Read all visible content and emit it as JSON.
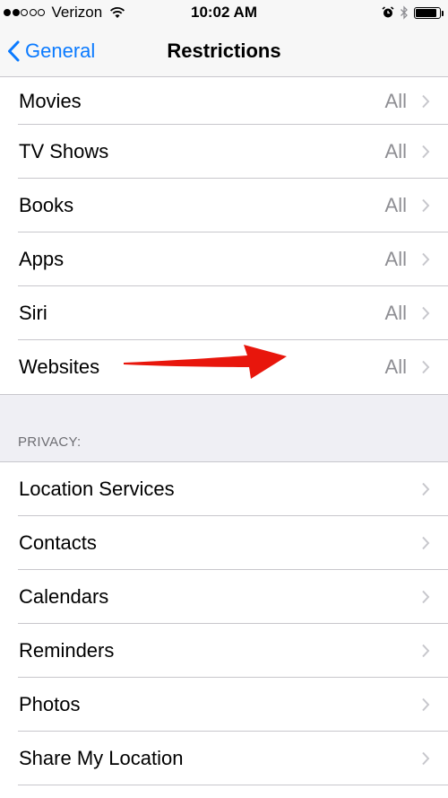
{
  "status_bar": {
    "carrier": "Verizon",
    "time": "10:02 AM",
    "signal_bars_filled": 2,
    "signal_bars_total": 5,
    "battery_level": 0.9,
    "icons": [
      "signal-dots-icon",
      "wifi-icon",
      "alarm-icon",
      "bluetooth-icon",
      "battery-icon"
    ]
  },
  "nav": {
    "back_label": "General",
    "title": "Restrictions"
  },
  "content_group": {
    "rows": [
      {
        "label": "Movies",
        "value": "All"
      },
      {
        "label": "TV Shows",
        "value": "All"
      },
      {
        "label": "Books",
        "value": "All"
      },
      {
        "label": "Apps",
        "value": "All"
      },
      {
        "label": "Siri",
        "value": "All"
      },
      {
        "label": "Websites",
        "value": "All"
      }
    ]
  },
  "privacy": {
    "header": "PRIVACY:",
    "rows": [
      {
        "label": "Location Services"
      },
      {
        "label": "Contacts"
      },
      {
        "label": "Calendars"
      },
      {
        "label": "Reminders"
      },
      {
        "label": "Photos"
      },
      {
        "label": "Share My Location"
      }
    ]
  },
  "colors": {
    "accent": "#0a7aff",
    "annotation_arrow": "#e8160c",
    "secondary_text": "#8e8e93",
    "grouped_background": "#efeff4"
  }
}
